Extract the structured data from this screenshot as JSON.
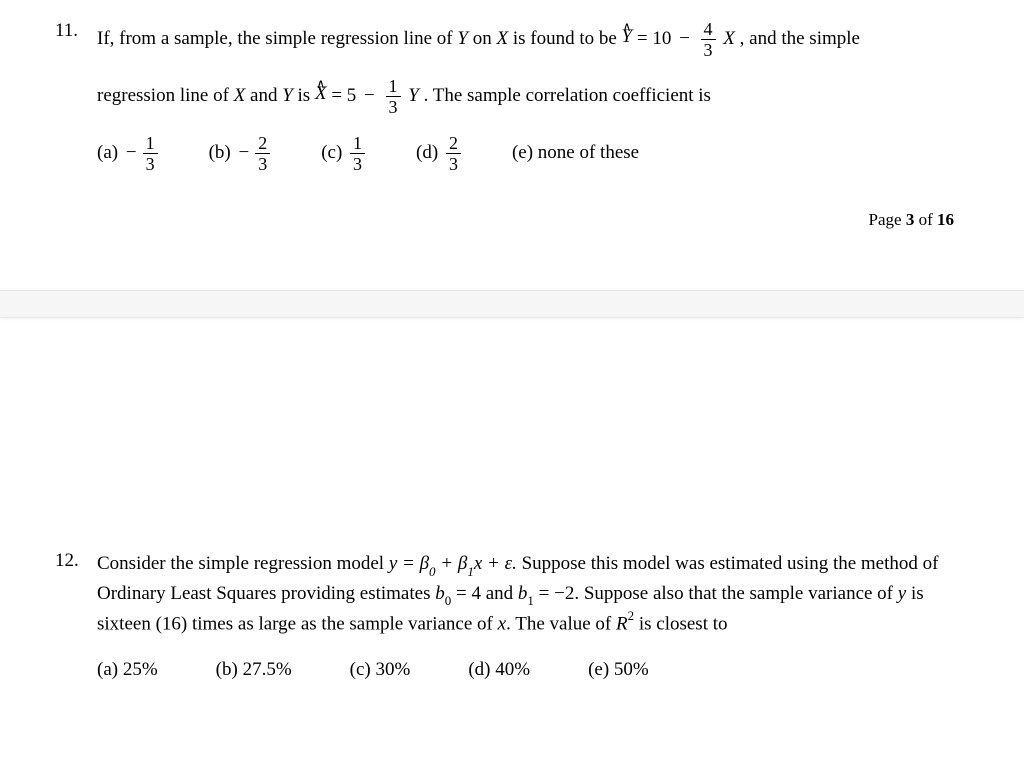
{
  "q11": {
    "number": "11.",
    "text_part1": "If, from a sample, the simple regression line of ",
    "Y": "Y",
    "on": " on ",
    "X": "X",
    "text_part2": " is found to be ",
    "eq1_lhs_var": "Y",
    "eq1_rhs_const": "= 10",
    "eq1_minus": "−",
    "eq1_frac_num": "4",
    "eq1_frac_den": "3",
    "eq1_X": "X",
    "text_part3": ", and the simple",
    "line2_part1": "regression line of ",
    "line2_X": "X",
    "line2_and": " and ",
    "line2_Y": "Y",
    "line2_is": " is ",
    "eq2_lhs_var": "X",
    "eq2_rhs_const": "= 5",
    "eq2_minus": "−",
    "eq2_frac_num": "1",
    "eq2_frac_den": "3",
    "eq2_Y": "Y",
    "line2_part2": ".  The sample correlation coefficient is",
    "options": {
      "a": {
        "label": "(a)",
        "sign": "−",
        "num": "1",
        "den": "3"
      },
      "b": {
        "label": "(b)",
        "sign": "−",
        "num": "2",
        "den": "3"
      },
      "c": {
        "label": "(c)",
        "num": "1",
        "den": "3"
      },
      "d": {
        "label": "(d)",
        "num": "2",
        "den": "3"
      },
      "e": {
        "label": "(e) none of these"
      }
    }
  },
  "page_footer": {
    "prefix": "Page ",
    "current": "3",
    "of": " of ",
    "total": "16"
  },
  "q12": {
    "number": "12.",
    "text1": "Consider the simple regression model ",
    "model": "y = β",
    "sub0": "0",
    "plus": " + β",
    "sub1": "1",
    "xeps": "x + ε. ",
    "text2": " Suppose this model was estimated using the method of Ordinary Least Squares providing estimates ",
    "b0": "b",
    "b0sub": "0",
    "b0eq": " = 4 and ",
    "b1": "b",
    "b1sub": "1",
    "b1eq": " = −2.  Suppose also that the sample variance of ",
    "y": "y",
    "text3": " is sixteen (16) times as large as the sample variance of ",
    "x": "x",
    "text4": ".  The value of ",
    "R": "R",
    "sq": "2",
    "text5": " is closest to",
    "options": {
      "a": "(a) 25%",
      "b": "(b) 27.5%",
      "c": "(c) 30%",
      "d": "(d) 40%",
      "e": "(e) 50%"
    }
  }
}
